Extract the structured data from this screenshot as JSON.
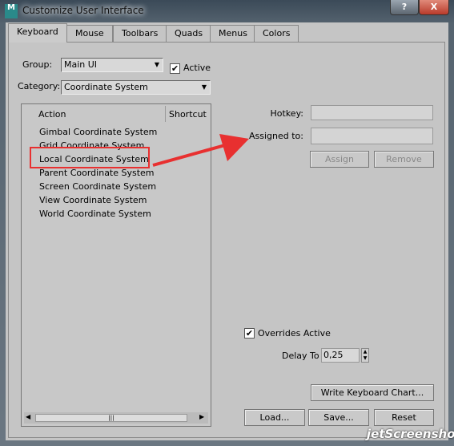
{
  "window": {
    "title": "Customize User Interface",
    "app_icon": "M",
    "help": "?",
    "close": "X"
  },
  "tabs": [
    "Keyboard",
    "Mouse",
    "Toolbars",
    "Quads",
    "Menus",
    "Colors"
  ],
  "group": {
    "label": "Group:",
    "value": "Main UI",
    "active_label": "Active",
    "active_checked": true
  },
  "category": {
    "label": "Category:",
    "value": "Coordinate System"
  },
  "list": {
    "columns": [
      "Action",
      "Shortcut"
    ],
    "items": [
      "Gimbal Coordinate System",
      "Grid Coordinate System",
      "Local Coordinate System",
      "Parent Coordinate System",
      "Screen Coordinate System",
      "View Coordinate System",
      "World Coordinate System"
    ],
    "highlighted": "Local Coordinate System"
  },
  "hotkey": {
    "label": "Hotkey:",
    "value": ""
  },
  "assigned": {
    "label": "Assigned to:",
    "value": ""
  },
  "buttons": {
    "assign": "Assign",
    "remove": "Remove",
    "write_chart": "Write Keyboard Chart...",
    "load": "Load...",
    "save": "Save...",
    "reset": "Reset"
  },
  "overrides": {
    "label": "Overrides Active",
    "checked": true
  },
  "delay": {
    "label": "Delay To",
    "value": "0,25"
  },
  "watermark": "jetScreenshot",
  "colors": {
    "annotation": "#e83030"
  }
}
